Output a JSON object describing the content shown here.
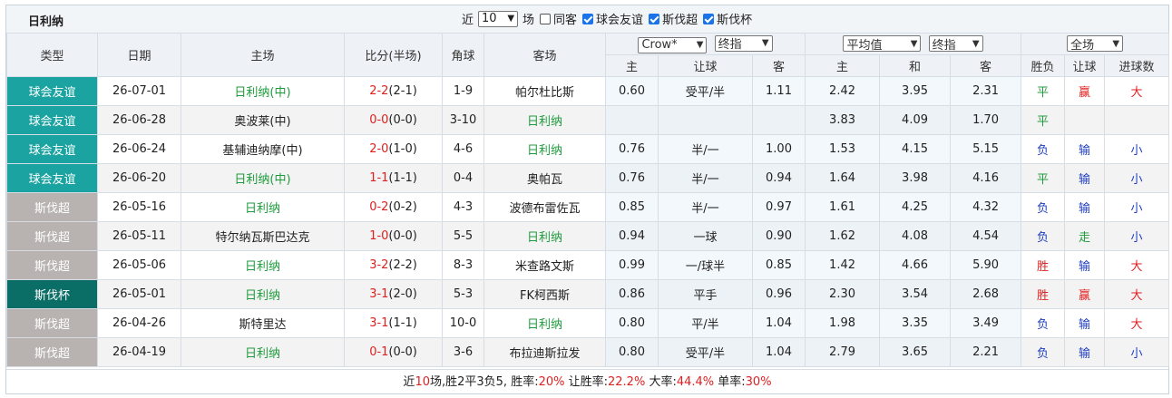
{
  "team_title": "日利纳",
  "filters": {
    "near_label": "近",
    "count_value": "10",
    "games_label": "场",
    "same_venue_label": "同客",
    "competitions": [
      "球会友谊",
      "斯伐超",
      "斯伐杯"
    ]
  },
  "header": {
    "type": "类型",
    "date": "日期",
    "home": "主场",
    "score": "比分(半场)",
    "corners": "角球",
    "away": "客场",
    "company_select": "Crow*",
    "handicap_select": "终指",
    "avg_select": "平均值",
    "avg_final_select": "终指",
    "scope_select": "全场",
    "sub": {
      "h_home": "主",
      "h_line": "让球",
      "h_away": "客",
      "e_home": "主",
      "e_draw": "和",
      "e_away": "客",
      "result": "胜负",
      "handicap_result": "让球",
      "goals": "进球数"
    }
  },
  "colors": {
    "friendly": "#1aa3a0",
    "league": "#b8b2b0",
    "cup": "#0b6e66"
  },
  "rows": [
    {
      "type": "球会友谊",
      "type_kind": "friendly",
      "date": "26-07-01",
      "home": "日利纳(中)",
      "home_hl": true,
      "score": "2-2",
      "half": "(2-1)",
      "score_color": "red",
      "corners": "1-9",
      "away": "帕尔杜比斯",
      "away_hl": false,
      "h_home": "0.60",
      "h_line": "受平/半",
      "h_away": "1.11",
      "e_home": "2.42",
      "e_draw": "3.95",
      "e_away": "2.31",
      "result": "平",
      "result_color": "grn",
      "hres": "赢",
      "hres_color": "red",
      "goals": "大",
      "goals_color": "red"
    },
    {
      "type": "球会友谊",
      "type_kind": "friendly",
      "date": "26-06-28",
      "home": "奥波莱(中)",
      "home_hl": false,
      "score": "0-0",
      "half": "(0-0)",
      "score_color": "red",
      "corners": "3-10",
      "away": "日利纳",
      "away_hl": true,
      "h_home": "",
      "h_line": "",
      "h_away": "",
      "e_home": "3.83",
      "e_draw": "4.09",
      "e_away": "1.70",
      "result": "平",
      "result_color": "grn",
      "hres": "",
      "hres_color": "red",
      "goals": "",
      "goals_color": "red"
    },
    {
      "type": "球会友谊",
      "type_kind": "friendly",
      "date": "26-06-24",
      "home": "基辅迪纳摩(中)",
      "home_hl": false,
      "score": "2-0",
      "half": "(1-0)",
      "score_color": "red",
      "corners": "4-6",
      "away": "日利纳",
      "away_hl": true,
      "h_home": "0.76",
      "h_line": "半/一",
      "h_away": "1.00",
      "e_home": "1.53",
      "e_draw": "4.15",
      "e_away": "5.15",
      "result": "负",
      "result_color": "blu",
      "hres": "输",
      "hres_color": "blu",
      "goals": "小",
      "goals_color": "blu"
    },
    {
      "type": "球会友谊",
      "type_kind": "friendly",
      "date": "26-06-20",
      "home": "日利纳(中)",
      "home_hl": true,
      "score": "1-1",
      "half": "(1-1)",
      "score_color": "red",
      "corners": "0-4",
      "away": "奥帕瓦",
      "away_hl": false,
      "h_home": "0.76",
      "h_line": "半/一",
      "h_away": "0.94",
      "e_home": "1.64",
      "e_draw": "3.98",
      "e_away": "4.16",
      "result": "平",
      "result_color": "grn",
      "hres": "输",
      "hres_color": "blu",
      "goals": "小",
      "goals_color": "blu"
    },
    {
      "type": "斯伐超",
      "type_kind": "league",
      "date": "26-05-16",
      "home": "日利纳",
      "home_hl": true,
      "score": "0-2",
      "half": "(0-2)",
      "score_color": "red",
      "corners": "4-3",
      "away": "波德布雷佐瓦",
      "away_hl": false,
      "h_home": "0.85",
      "h_line": "半/一",
      "h_away": "0.97",
      "e_home": "1.61",
      "e_draw": "4.25",
      "e_away": "4.32",
      "result": "负",
      "result_color": "blu",
      "hres": "输",
      "hres_color": "blu",
      "goals": "小",
      "goals_color": "blu"
    },
    {
      "type": "斯伐超",
      "type_kind": "league",
      "date": "26-05-11",
      "home": "特尔纳瓦斯巴达克",
      "home_hl": false,
      "score": "1-0",
      "half": "(0-0)",
      "score_color": "red",
      "corners": "5-5",
      "away": "日利纳",
      "away_hl": true,
      "h_home": "0.94",
      "h_line": "一球",
      "h_away": "0.90",
      "e_home": "1.62",
      "e_draw": "4.08",
      "e_away": "4.54",
      "result": "负",
      "result_color": "blu",
      "hres": "走",
      "hres_color": "grn",
      "goals": "小",
      "goals_color": "blu"
    },
    {
      "type": "斯伐超",
      "type_kind": "league",
      "date": "26-05-06",
      "home": "日利纳",
      "home_hl": true,
      "score": "3-2",
      "half": "(2-2)",
      "score_color": "red",
      "corners": "8-3",
      "away": "米查路文斯",
      "away_hl": false,
      "h_home": "0.99",
      "h_line": "一/球半",
      "h_away": "0.85",
      "e_home": "1.42",
      "e_draw": "4.66",
      "e_away": "5.90",
      "result": "胜",
      "result_color": "red",
      "hres": "输",
      "hres_color": "blu",
      "goals": "大",
      "goals_color": "red"
    },
    {
      "type": "斯伐杯",
      "type_kind": "cup",
      "date": "26-05-01",
      "home": "日利纳",
      "home_hl": true,
      "score": "3-1",
      "half": "(2-0)",
      "score_color": "red",
      "corners": "5-3",
      "away": "FK柯西斯",
      "away_hl": false,
      "h_home": "0.86",
      "h_line": "平手",
      "h_away": "0.96",
      "e_home": "2.30",
      "e_draw": "3.54",
      "e_away": "2.68",
      "result": "胜",
      "result_color": "red",
      "hres": "赢",
      "hres_color": "red",
      "goals": "大",
      "goals_color": "red"
    },
    {
      "type": "斯伐超",
      "type_kind": "league",
      "date": "26-04-26",
      "home": "斯特里达",
      "home_hl": false,
      "score": "3-1",
      "half": "(1-1)",
      "score_color": "red",
      "corners": "10-0",
      "away": "日利纳",
      "away_hl": true,
      "h_home": "0.80",
      "h_line": "平/半",
      "h_away": "1.04",
      "e_home": "1.98",
      "e_draw": "3.35",
      "e_away": "3.49",
      "result": "负",
      "result_color": "blu",
      "hres": "输",
      "hres_color": "blu",
      "goals": "大",
      "goals_color": "red"
    },
    {
      "type": "斯伐超",
      "type_kind": "league",
      "date": "26-04-19",
      "home": "日利纳",
      "home_hl": true,
      "score": "0-1",
      "half": "(0-0)",
      "score_color": "red",
      "corners": "3-6",
      "away": "布拉迪斯拉发",
      "away_hl": false,
      "h_home": "0.80",
      "h_line": "受平/半",
      "h_away": "1.04",
      "e_home": "2.79",
      "e_draw": "3.65",
      "e_away": "2.21",
      "result": "负",
      "result_color": "blu",
      "hres": "输",
      "hres_color": "blu",
      "goals": "小",
      "goals_color": "blu"
    }
  ],
  "summary": {
    "prefix": "近",
    "count": "10",
    "mid": "场,胜2平3负5, 胜率:",
    "win_rate": "20%",
    "hc_label": " 让胜率:",
    "hc_rate": "22.2%",
    "big_label": " 大率:",
    "big_rate": "44.4%",
    "odd_label": " 单率:",
    "odd_rate": "30%"
  }
}
